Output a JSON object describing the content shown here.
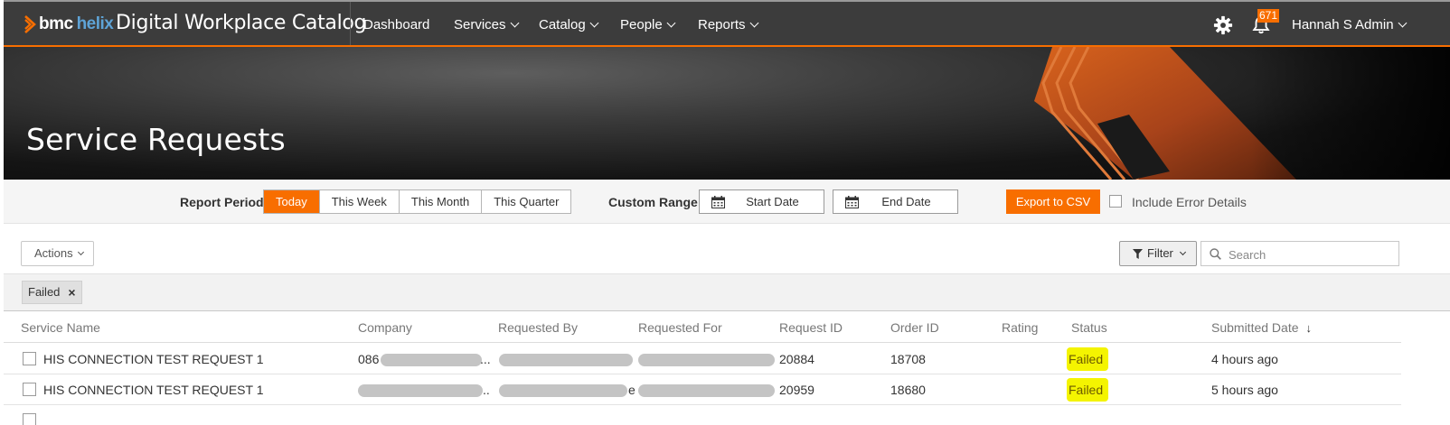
{
  "header": {
    "logo_bmc": "bmc",
    "logo_helix": "helix",
    "app_title": "Digital Workplace Catalog",
    "nav": [
      "Dashboard",
      "Services",
      "Catalog",
      "People",
      "Reports"
    ],
    "notification_count": "671",
    "user_name": "Hannah S Admin",
    "icons": {
      "settings": "gear-icon",
      "notifications": "bell-icon"
    },
    "colors": {
      "bar": "#3c3c3c",
      "accent": "#f86e00",
      "helix_blue": "#5ea3d6"
    }
  },
  "banner": {
    "title": "Service Requests"
  },
  "report_period": {
    "label": "Report Period",
    "options": [
      "Today",
      "This Week",
      "This Month",
      "This Quarter"
    ],
    "selected": "Today",
    "custom_range_label": "Custom Range",
    "start_date_placeholder": "Start Date",
    "end_date_placeholder": "End Date",
    "export_label": "Export to CSV",
    "include_errors_label": "Include Error Details"
  },
  "toolbar": {
    "actions_label": "Actions",
    "filter_label": "Filter",
    "search_placeholder": "Search"
  },
  "filters": {
    "active_chip": "Failed"
  },
  "table": {
    "columns": [
      "Service Name",
      "Company",
      "Requested By",
      "Requested For",
      "Request ID",
      "Order ID",
      "Rating",
      "Status",
      "Submitted Date"
    ],
    "sort_column": "Submitted Date",
    "sort_direction": "descending",
    "rows": [
      {
        "service_name": "HIS CONNECTION TEST REQUEST 1",
        "company": "086",
        "company_trail": "...",
        "requested_by_trail": "..",
        "request_id": "20884",
        "order_id": "18708",
        "rating": "",
        "status": "Failed",
        "submitted": "4 hours ago"
      },
      {
        "service_name": "HIS CONNECTION TEST REQUEST 1",
        "company": "",
        "company_trail": "..",
        "requested_by_trail": "e",
        "request_id": "20959",
        "order_id": "18680",
        "rating": "",
        "status": "Failed",
        "submitted": "5 hours ago"
      }
    ],
    "status_highlight_color": "#f4f400"
  }
}
